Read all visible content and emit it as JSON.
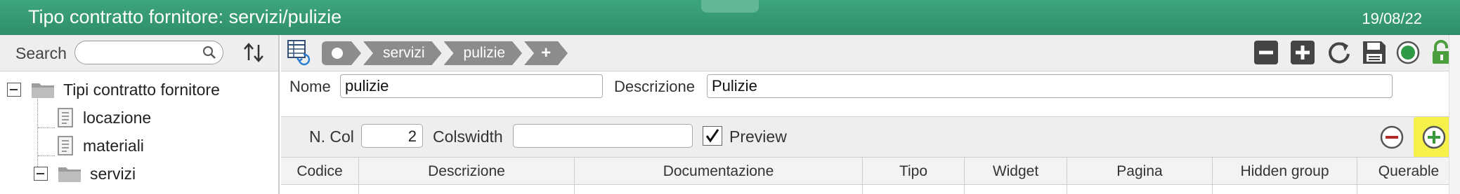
{
  "window": {
    "title": "Tipo contratto fornitore: servizi/pulizie",
    "date": "19/08/22"
  },
  "sidebar": {
    "search_label": "Search",
    "search_value": "",
    "tree": [
      {
        "label": "Tipi contratto fornitore",
        "type": "folder",
        "expanded": true
      },
      {
        "label": "locazione",
        "type": "document"
      },
      {
        "label": "materiali",
        "type": "document"
      },
      {
        "label": "servizi",
        "type": "folder",
        "expanded": true
      }
    ]
  },
  "toolbar": {
    "breadcrumbs": [
      "servizi",
      "pulizie"
    ],
    "add_crumb": "+",
    "icons": [
      "grid-icon",
      "minus-icon",
      "plus-icon",
      "refresh-icon",
      "save-icon",
      "status-dot-icon",
      "unlock-icon"
    ],
    "accent": "#3a9b73"
  },
  "form": {
    "nome_label": "Nome",
    "nome_value": "pulizie",
    "descrizione_label": "Descrizione",
    "descrizione_value": "Pulizie"
  },
  "config": {
    "ncol_label": "N. Col",
    "ncol_value": "2",
    "colswidth_label": "Colswidth",
    "colswidth_value": "",
    "preview_label": "Preview",
    "preview_checked": true
  },
  "table": {
    "columns": [
      "Codice",
      "Descrizione",
      "Documentazione",
      "Tipo",
      "Widget",
      "Pagina",
      "Hidden group",
      "Querable"
    ]
  }
}
